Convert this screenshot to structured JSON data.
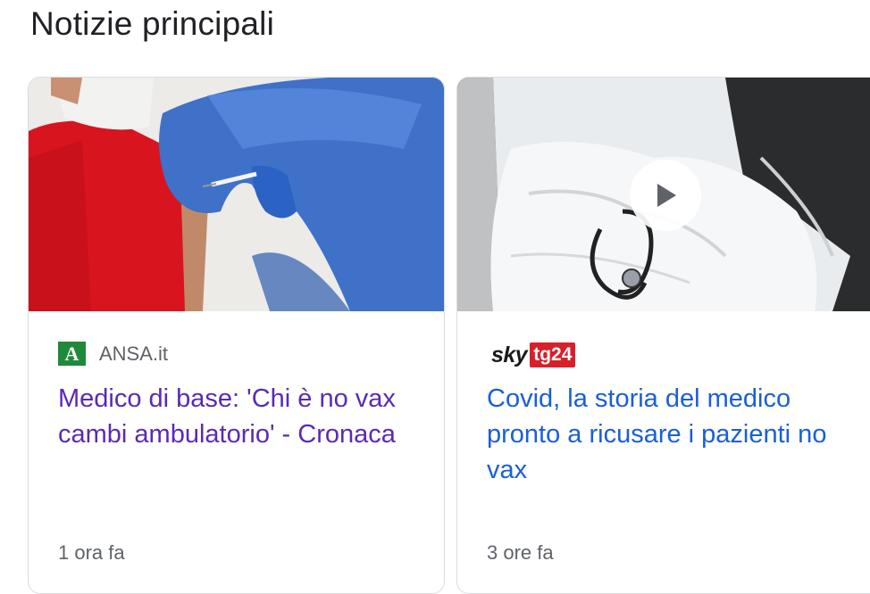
{
  "section": {
    "title": "Notizie principali"
  },
  "cards": [
    {
      "source": "ANSA.it",
      "source_logo_letter": "A",
      "headline": "Medico di base: 'Chi è no vax cambi ambulatorio' - Cronaca",
      "time": "1 ora fa",
      "headline_color": "#5a2ab5",
      "image_icon": "vaccination-photo"
    },
    {
      "source_logo_sky": "sky",
      "source_logo_tg": "tg24",
      "headline": "Covid, la storia del medico pronto a ricusare i pazienti no vax",
      "time": "3 ore fa",
      "headline_color": "#1a5fd6",
      "image_icon": "stethoscope-photo",
      "play_icon": "play-icon"
    }
  ]
}
